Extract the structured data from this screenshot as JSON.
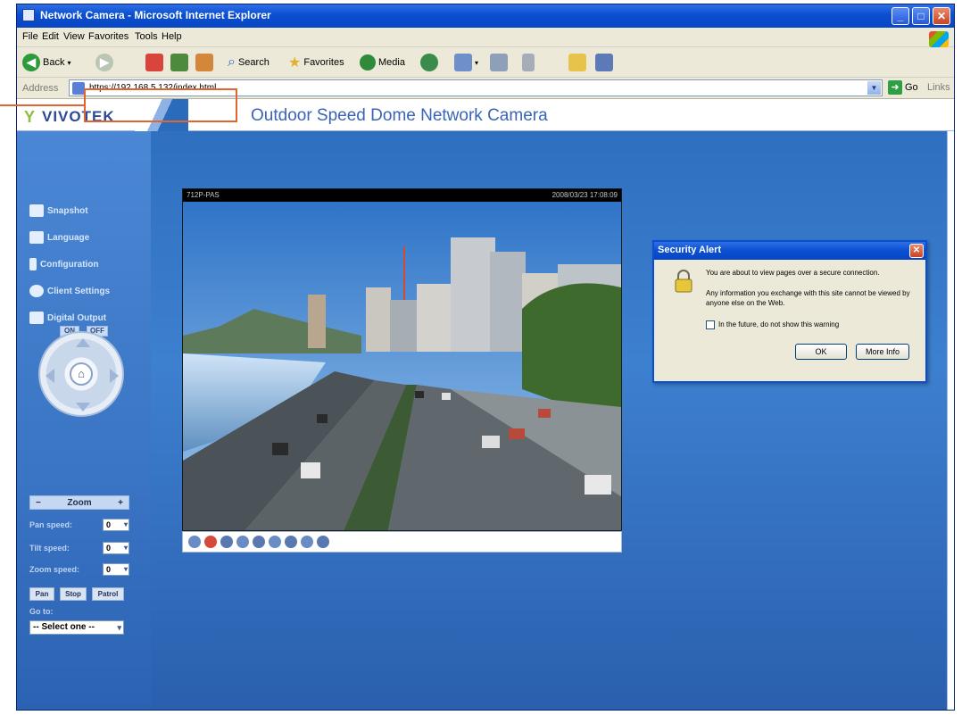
{
  "window": {
    "title": "Network Camera - Microsoft Internet Explorer",
    "controls": {
      "minimize": "_",
      "maximize": "□",
      "close": "✕"
    }
  },
  "menu": [
    "File",
    "Edit",
    "View",
    "Favorites",
    "Tools",
    "Help"
  ],
  "toolbar": {
    "back": "Back",
    "search": "Search",
    "favorites": "Favorites",
    "media": "Media"
  },
  "address": {
    "label": "Address",
    "url": "https://192.168.5.132/index.html",
    "go": "Go",
    "links": "Links"
  },
  "page": {
    "brand": "VIVOTEK",
    "title": "Outdoor Speed Dome Network Camera"
  },
  "sidebar": {
    "links": [
      "Snapshot",
      "Language",
      "Configuration",
      "Client Settings",
      "Digital Output"
    ],
    "digital_output_buttons": [
      "ON",
      "OFF"
    ],
    "zoom": {
      "minus": "−",
      "label": "Zoom",
      "plus": "+"
    },
    "pan_speed": {
      "label": "Pan speed:",
      "value": "0"
    },
    "tilt_speed": {
      "label": "Tilt speed:",
      "value": "0"
    },
    "zoom_speed": {
      "label": "Zoom speed:",
      "value": "0"
    },
    "actions": [
      "Pan",
      "Stop",
      "Patrol"
    ],
    "goto_label": "Go to:",
    "goto_value": "-- Select one --"
  },
  "video": {
    "camera_id": "712P-PAS",
    "timestamp": "2008/03/23 17:08:09"
  },
  "dialog": {
    "title": "Security Alert",
    "message": "You are about to view pages over a secure connection.",
    "detail": "Any information you exchange with this site cannot be viewed by anyone else on the Web.",
    "checkbox_label": "In the future, do not show this warning",
    "ok": "OK",
    "more_info": "More Info"
  },
  "colors": {
    "callout": "#e0662f",
    "xp_blue": "#0a4fd1",
    "page_blue": "#2b6bbb",
    "title_blue": "#3a64b8"
  }
}
